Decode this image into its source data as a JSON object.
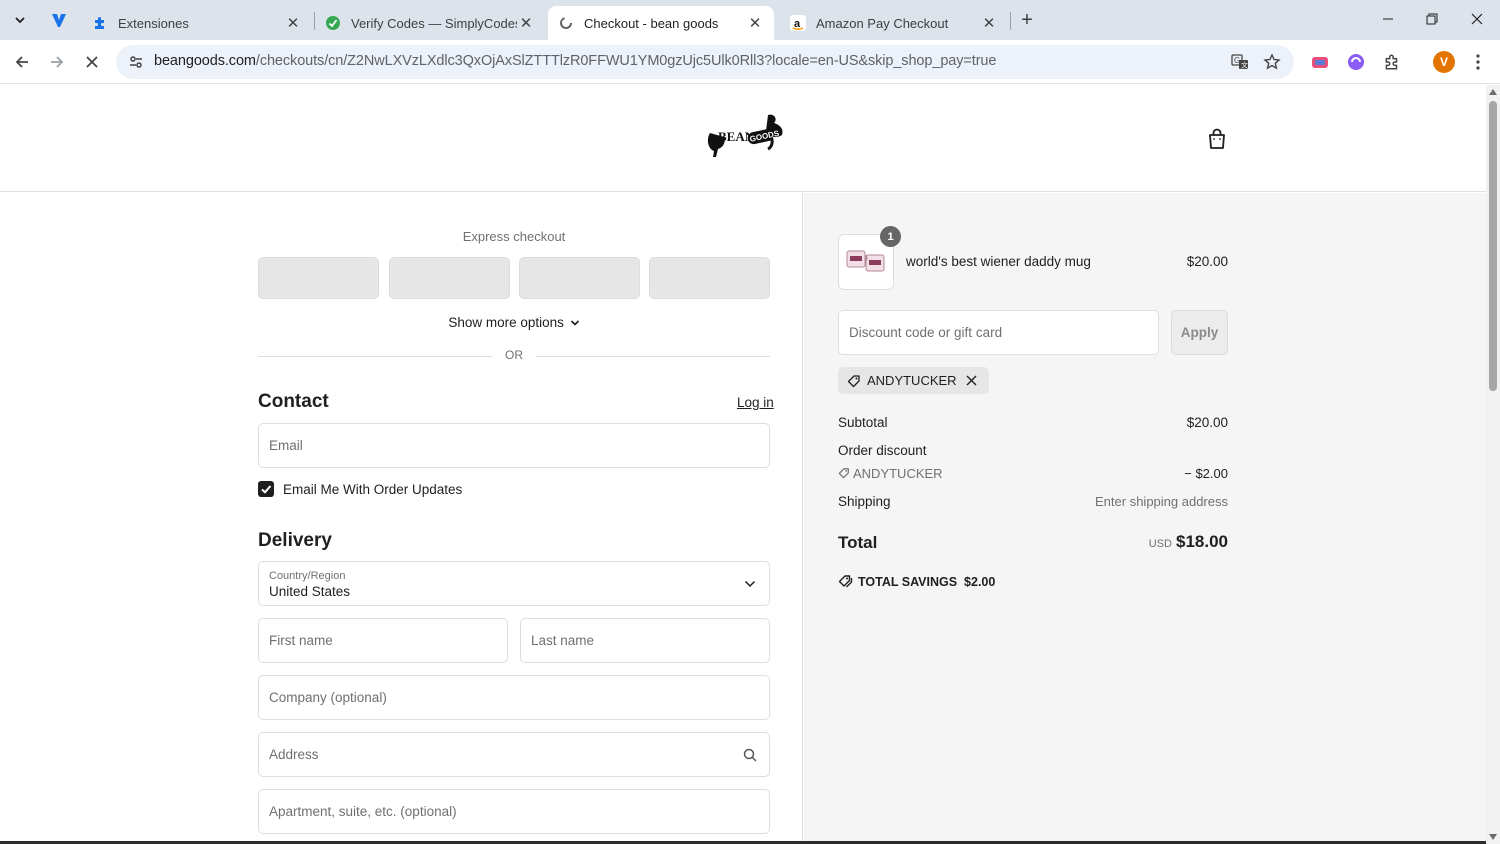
{
  "browser": {
    "tabs": [
      {
        "title": "Extensiones",
        "icon": "puzzle-icon",
        "active": false
      },
      {
        "title": "Verify Codes — SimplyCodes",
        "icon": "simplycodes-icon",
        "active": false
      },
      {
        "title": "Checkout - bean goods",
        "icon": "loading-favicon-icon",
        "active": true
      },
      {
        "title": "Amazon Pay Checkout",
        "icon": "amazon-icon",
        "active": false
      }
    ],
    "url_host": "beangoods.com",
    "url_path": "/checkouts/cn/Z2NwLXVzLXdlc3QxOjAxSlZTTTlzR0FFWU1YM0gzUjc5Ulk0Rll3?locale=en-US&skip_shop_pay=true",
    "profile_initial": "V",
    "colors": {
      "tabstrip": "#dde3ea",
      "omnibox": "#edf2fa",
      "profile": "#e37400"
    }
  },
  "header": {
    "logo_text": "BEAN GOODS"
  },
  "express": {
    "title": "Express checkout",
    "show_more": "Show more options",
    "or": "OR"
  },
  "contact": {
    "heading": "Contact",
    "login": "Log in",
    "email_placeholder": "Email",
    "email_updates_label": "Email Me With Order Updates",
    "email_updates_checked": true
  },
  "delivery": {
    "heading": "Delivery",
    "country_label": "Country/Region",
    "country_value": "United States",
    "first_name_placeholder": "First name",
    "last_name_placeholder": "Last name",
    "company_placeholder": "Company (optional)",
    "address_placeholder": "Address",
    "apartment_placeholder": "Apartment, suite, etc. (optional)"
  },
  "summary": {
    "item": {
      "name": "world's best wiener daddy mug",
      "price": "$20.00",
      "quantity": "1"
    },
    "discount_placeholder": "Discount code or gift card",
    "apply": "Apply",
    "applied_code": "ANDYTUCKER",
    "subtotal_label": "Subtotal",
    "subtotal_value": "$20.00",
    "order_discount_label": "Order discount",
    "discount_code": "ANDYTUCKER",
    "discount_value": "− $2.00",
    "shipping_label": "Shipping",
    "shipping_value": "Enter shipping address",
    "total_label": "Total",
    "currency": "USD",
    "total_value": "$18.00",
    "savings_label": "TOTAL SAVINGS",
    "savings_value": "$2.00"
  }
}
